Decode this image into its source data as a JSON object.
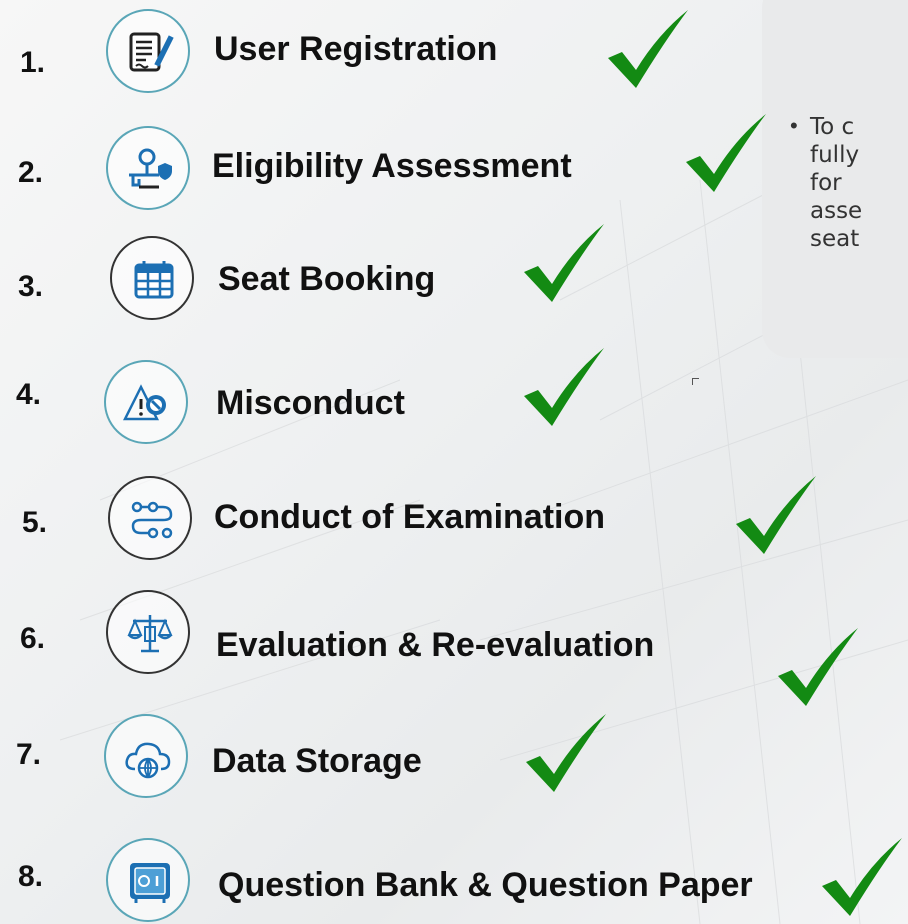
{
  "items": [
    {
      "num": "1.",
      "title": "User Registration",
      "icon": "document-edit-icon"
    },
    {
      "num": "2.",
      "title": "Eligibility Assessment",
      "icon": "desk-shield-icon"
    },
    {
      "num": "3.",
      "title": "Seat Booking",
      "icon": "calendar-icon"
    },
    {
      "num": "4.",
      "title": "Misconduct",
      "icon": "warning-prohibited-icon"
    },
    {
      "num": "5.",
      "title": "Conduct of Examination",
      "icon": "workflow-icon"
    },
    {
      "num": "6.",
      "title": "Evaluation & Re-evaluation",
      "icon": "scales-icon"
    },
    {
      "num": "7.",
      "title": "Data Storage",
      "icon": "cloud-globe-icon"
    },
    {
      "num": "8.",
      "title": "Question Bank & Question Paper",
      "icon": "safe-icon"
    }
  ],
  "panel": {
    "bullet": "•",
    "lines": [
      "To c",
      "fully",
      "for",
      "asse",
      "seat"
    ]
  },
  "colors": {
    "check": "#138a13",
    "ring": "#5aa6b7",
    "accent_blue": "#1c6fb3"
  }
}
